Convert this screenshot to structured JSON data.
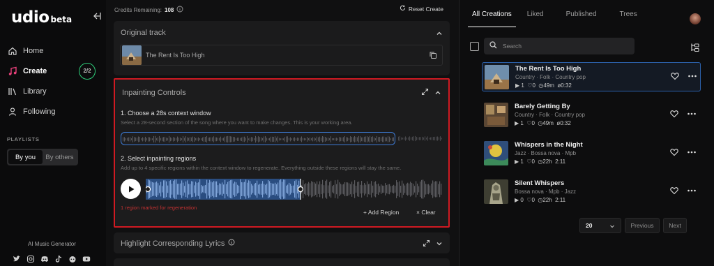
{
  "brand": {
    "name": "udio",
    "tag": "beta"
  },
  "nav": [
    {
      "label": "Home",
      "icon": "home-icon"
    },
    {
      "label": "Create",
      "icon": "music-note-icon",
      "badge": "2/2"
    },
    {
      "label": "Library",
      "icon": "library-icon"
    },
    {
      "label": "Following",
      "icon": "user-icon"
    }
  ],
  "playlists": {
    "title": "PLAYLISTS",
    "by_you": "By you",
    "by_others": "By others"
  },
  "footer": {
    "label": "AI Music Generator"
  },
  "credits": {
    "label": "Credits Remaining:",
    "value": "108"
  },
  "reset_label": "Reset Create",
  "original": {
    "title": "Original track",
    "track_name": "The Rent Is Too High"
  },
  "inpainting": {
    "title": "Inpainting Controls",
    "step1": "1. Choose a 28s context window",
    "desc1": "Select a 28-second section of the song where you want to make changes. This is your working area.",
    "step2": "2. Select inpainting regions",
    "desc2": "Add up to 4 specific regions within the context window to regenerate. Everything outside these regions will stay the same.",
    "region_note": "1 region marked for regeneration",
    "add_region": "+ Add Region",
    "clear": "× Clear",
    "selection_fraction": 0.52
  },
  "highlight": {
    "title": "Highlight Corresponding Lyrics"
  },
  "right": {
    "tabs": [
      "All Creations",
      "Liked",
      "Published",
      "Trees"
    ],
    "active_tab": 0,
    "search_placeholder": "Search",
    "songs": [
      {
        "title": "The Rent Is Too High",
        "tags": "Country  ·  Folk  ·  Country pop",
        "plays": "1",
        "likes": "0",
        "age": "49m",
        "duration": "0:32",
        "selected": true
      },
      {
        "title": "Barely Getting By",
        "tags": "Country  ·  Folk  ·  Country pop",
        "plays": "1",
        "likes": "0",
        "age": "49m",
        "duration": "0:32"
      },
      {
        "title": "Whispers in the Night",
        "tags": "Jazz  ·  Bossa nova  ·  Mpb",
        "plays": "1",
        "likes": "0",
        "age": "22h",
        "duration": "2:11"
      },
      {
        "title": "Silent Whispers",
        "tags": "Bossa nova  ·  Mpb  ·  Jazz",
        "plays": "0",
        "likes": "0",
        "age": "22h",
        "duration": "2:11"
      }
    ],
    "page_size": "20",
    "previous": "Previous",
    "next": "Next"
  },
  "colors": {
    "accent_red": "#d01a22",
    "selection_blue": "#3d7bd6",
    "badge_green": "#2fd07b"
  }
}
